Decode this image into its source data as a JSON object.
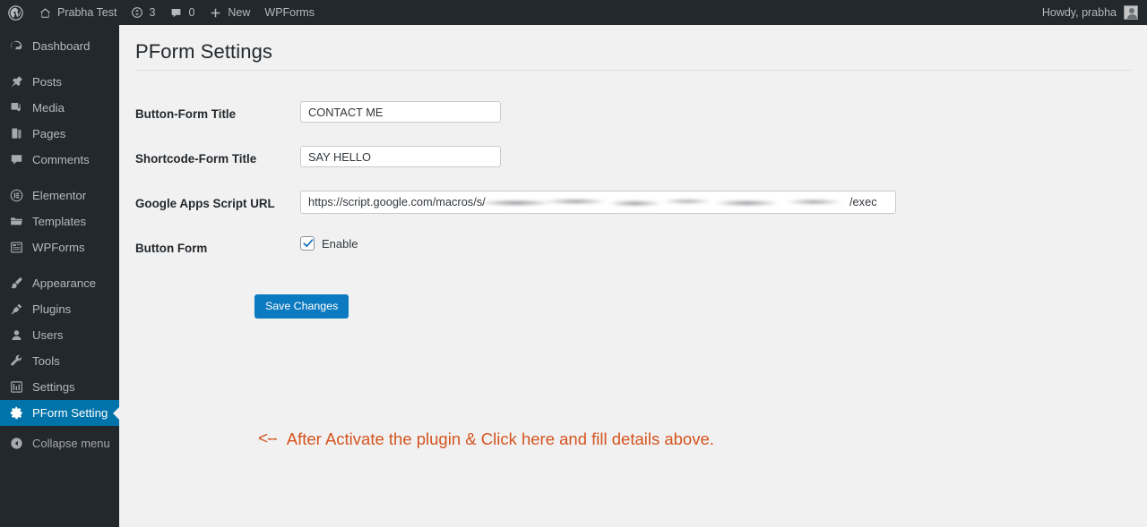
{
  "adminbar": {
    "logo_icon": "wordpress-logo-icon",
    "site_icon": "home-icon",
    "site_name": "Prabha Test",
    "updates_icon": "updates-icon",
    "updates_count": "3",
    "comments_icon": "comment-bubble-icon",
    "comments_count": "0",
    "new_icon": "plus-icon",
    "new_label": "New",
    "wpforms_label": "WPForms",
    "howdy": "Howdy, prabha",
    "avatar_icon": "user-avatar-icon"
  },
  "sidebar": {
    "items": [
      {
        "label": "Dashboard",
        "icon": "dashboard-icon",
        "active": false
      },
      {
        "label": "Posts",
        "icon": "pin-icon",
        "active": false
      },
      {
        "label": "Media",
        "icon": "media-icon",
        "active": false
      },
      {
        "label": "Pages",
        "icon": "pages-icon",
        "active": false
      },
      {
        "label": "Comments",
        "icon": "comment-icon",
        "active": false
      },
      {
        "label": "Elementor",
        "icon": "elementor-icon",
        "active": false
      },
      {
        "label": "Templates",
        "icon": "folder-icon",
        "active": false
      },
      {
        "label": "WPForms",
        "icon": "wpforms-icon",
        "active": false
      },
      {
        "label": "Appearance",
        "icon": "brush-icon",
        "active": false
      },
      {
        "label": "Plugins",
        "icon": "plug-icon",
        "active": false
      },
      {
        "label": "Users",
        "icon": "user-icon",
        "active": false
      },
      {
        "label": "Tools",
        "icon": "wrench-icon",
        "active": false
      },
      {
        "label": "Settings",
        "icon": "settings-icon",
        "active": false
      },
      {
        "label": "PForm Setting",
        "icon": "gear-icon",
        "active": true
      }
    ],
    "collapse_label": "Collapse menu",
    "collapse_icon": "collapse-arrow-icon",
    "active_color": "#0073aa",
    "background_color": "#23282d"
  },
  "main": {
    "page_title": "PForm Settings",
    "fields": {
      "button_form_title": {
        "label": "Button-Form Title",
        "value": "CONTACT ME",
        "placeholder": ""
      },
      "shortcode_form_title": {
        "label": "Shortcode-Form Title",
        "value": "SAY HELLO",
        "placeholder": ""
      },
      "script_url": {
        "label": "Google Apps Script URL",
        "value_prefix": "https://script.google.com/macros/s/",
        "value_redacted": "[redacted script id]",
        "value_suffix": "/exec"
      },
      "button_form": {
        "label": "Button Form",
        "checkbox_label": "Enable",
        "checked": true
      }
    },
    "save_label": "Save Changes",
    "save_color": "#0c7ac0"
  },
  "annotation": {
    "arrow": "<--",
    "text": "After Activate the plugin & Click here and fill details above.",
    "color": "#d4541e"
  }
}
